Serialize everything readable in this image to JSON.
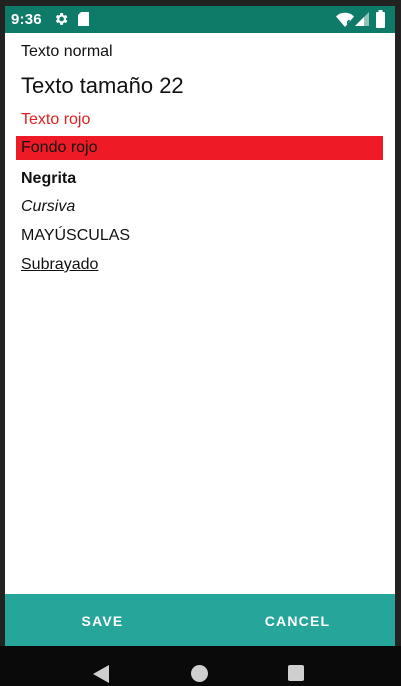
{
  "status_bar": {
    "time": "9:36",
    "background_color": "#0e7a68",
    "icons": [
      "gear-icon",
      "sd-card-icon",
      "wifi-icon",
      "signal-icon",
      "battery-icon"
    ]
  },
  "lines": {
    "normal": "Texto normal",
    "size22": "Texto tamaño 22",
    "red_text": "Texto rojo",
    "red_background": "Fondo rojo",
    "bold": "Negrita",
    "italic": "Cursiva",
    "uppercase": "MAYÚSCULAS",
    "underline": "Subrayado"
  },
  "colors": {
    "red_text": "#e0201f",
    "red_background": "#ee1b26",
    "button_bar": "#26a69a"
  },
  "buttons": {
    "save": "SAVE",
    "cancel": "CANCEL"
  },
  "navigation": {
    "icons": [
      "back-icon",
      "home-icon",
      "recents-icon"
    ]
  }
}
